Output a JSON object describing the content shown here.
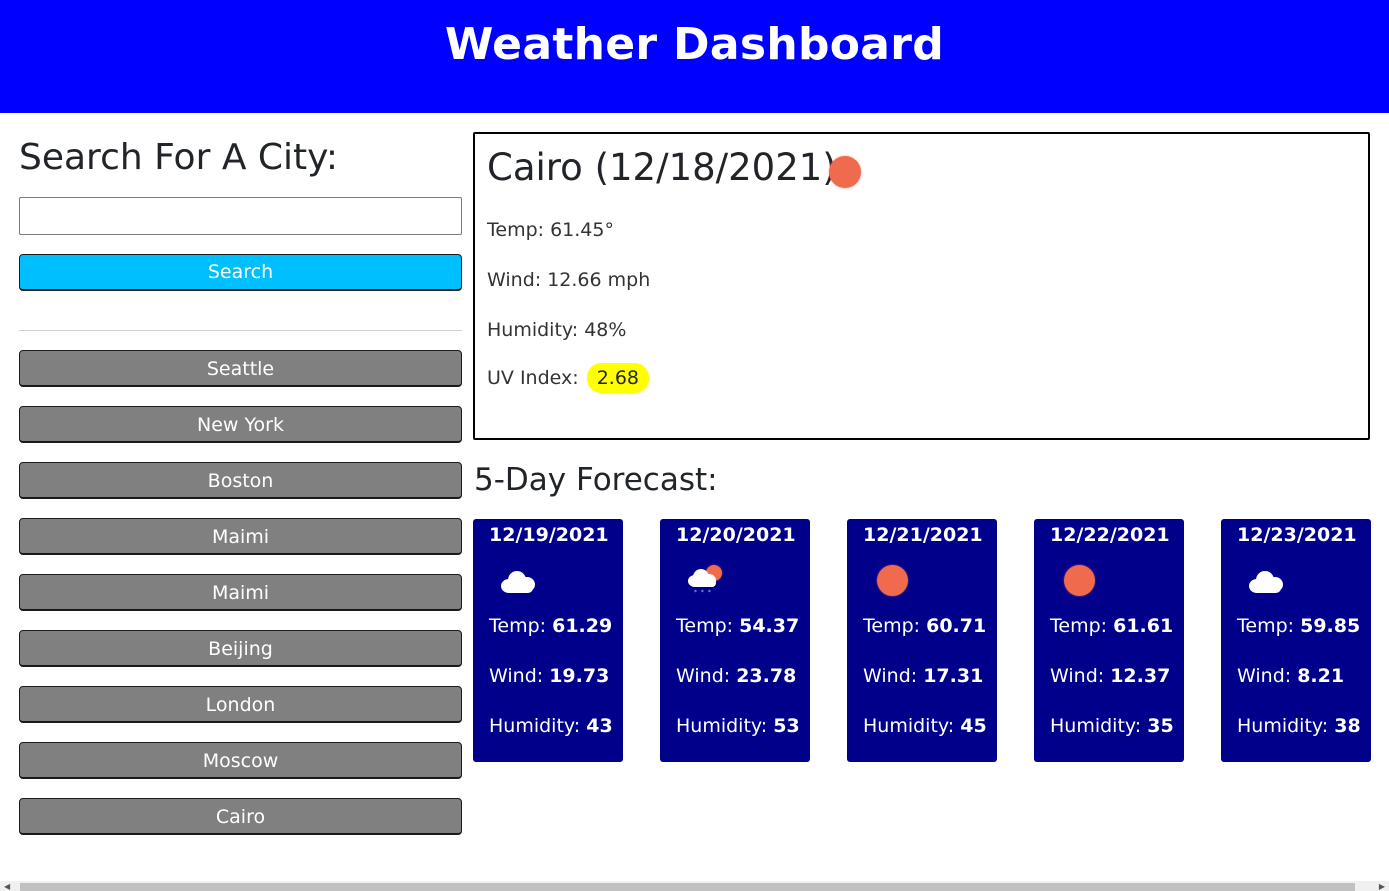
{
  "header": {
    "title": "Weather Dashboard"
  },
  "search": {
    "title": "Search For A City:",
    "input_value": "",
    "placeholder": "",
    "button_label": "Search"
  },
  "history": [
    {
      "label": "Seattle"
    },
    {
      "label": "New York"
    },
    {
      "label": "Boston"
    },
    {
      "label": "Maimi"
    },
    {
      "label": "Maimi"
    },
    {
      "label": "Beijing"
    },
    {
      "label": "London"
    },
    {
      "label": "Moscow"
    },
    {
      "label": "Cairo"
    }
  ],
  "current": {
    "title": "Cairo (12/18/2021)",
    "icon": "sun-icon",
    "temp": "Temp: 61.45°",
    "wind": "Wind: 12.66 mph",
    "humidity": "Humidity: 48%",
    "uv_label": "UV Index:",
    "uv_value": "2.68",
    "uv_color": "#ffff00"
  },
  "forecast": {
    "title": "5-Day Forecast:",
    "temp_label": "Temp:",
    "wind_label": "Wind:",
    "humidity_label": "Humidity:",
    "days": [
      {
        "date": "12/19/2021",
        "icon": "cloud-icon",
        "temp": "61.29",
        "wind": "19.73",
        "humidity": "43"
      },
      {
        "date": "12/20/2021",
        "icon": "snow-sun-icon",
        "temp": "54.37",
        "wind": "23.78",
        "humidity": "53"
      },
      {
        "date": "12/21/2021",
        "icon": "sun-icon",
        "temp": "60.71",
        "wind": "17.31",
        "humidity": "45"
      },
      {
        "date": "12/22/2021",
        "icon": "sun-icon",
        "temp": "61.61",
        "wind": "12.37",
        "humidity": "35"
      },
      {
        "date": "12/23/2021",
        "icon": "cloud-icon",
        "temp": "59.85",
        "wind": "8.21",
        "humidity": "38"
      }
    ]
  },
  "colors": {
    "header_bg": "#0000ff",
    "search_button": "#00bfff",
    "history_button": "#808080",
    "forecast_card": "#00008b",
    "sun": "#f06b4d"
  }
}
